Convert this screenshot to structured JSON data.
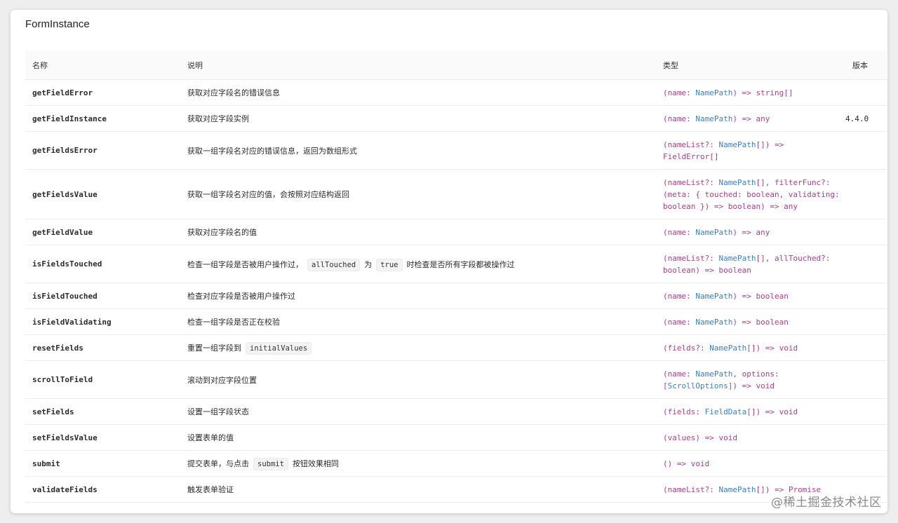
{
  "section_title": "FormInstance",
  "columns": {
    "name": "名称",
    "desc": "说明",
    "type": "类型",
    "version": "版本"
  },
  "rows": [
    {
      "name": "getFieldError",
      "desc": [
        "获取对应字段名的错误信息"
      ],
      "type": [
        [
          "p",
          "(name: "
        ],
        [
          "t",
          "NamePath"
        ],
        [
          "p",
          ") => string[]"
        ]
      ],
      "version": ""
    },
    {
      "name": "getFieldInstance",
      "desc": [
        "获取对应字段实例"
      ],
      "type": [
        [
          "p",
          "(name: "
        ],
        [
          "t",
          "NamePath"
        ],
        [
          "p",
          ") => any"
        ]
      ],
      "version": "4.4.0"
    },
    {
      "name": "getFieldsError",
      "desc": [
        "获取一组字段名对应的错误信息，返回为数组形式"
      ],
      "type": [
        [
          "p",
          "(nameList?: "
        ],
        [
          "t",
          "NamePath"
        ],
        [
          "p",
          "[]) =>"
        ],
        [
          "br",
          ""
        ],
        [
          "p",
          "FieldError[]"
        ]
      ],
      "version": ""
    },
    {
      "name": "getFieldsValue",
      "desc": [
        "获取一组字段名对应的值，会按照对应结构返回"
      ],
      "type": [
        [
          "p",
          "(nameList?: "
        ],
        [
          "t",
          "NamePath"
        ],
        [
          "p",
          "[], filterFunc?:"
        ],
        [
          "br",
          ""
        ],
        [
          "p",
          "(meta: { touched: boolean, validating:"
        ],
        [
          "br",
          ""
        ],
        [
          "p",
          "boolean }) => boolean) => any"
        ]
      ],
      "version": ""
    },
    {
      "name": "getFieldValue",
      "desc": [
        "获取对应字段名的值"
      ],
      "type": [
        [
          "p",
          "(name: "
        ],
        [
          "t",
          "NamePath"
        ],
        [
          "p",
          ") => any"
        ]
      ],
      "version": ""
    },
    {
      "name": "isFieldsTouched",
      "desc": [
        "检查一组字段是否被用户操作过，",
        "allTouched",
        "为",
        "true",
        "时检查是否所有字段都被操作过"
      ],
      "type": [
        [
          "p",
          "(nameList?: "
        ],
        [
          "t",
          "NamePath"
        ],
        [
          "p",
          "[], allTouched?:"
        ],
        [
          "br",
          ""
        ],
        [
          "p",
          "boolean) => boolean"
        ]
      ],
      "version": ""
    },
    {
      "name": "isFieldTouched",
      "desc": [
        "检查对应字段是否被用户操作过"
      ],
      "type": [
        [
          "p",
          "(name: "
        ],
        [
          "t",
          "NamePath"
        ],
        [
          "p",
          ") => boolean"
        ]
      ],
      "version": ""
    },
    {
      "name": "isFieldValidating",
      "desc": [
        "检查一组字段是否正在校验"
      ],
      "type": [
        [
          "p",
          "(name: "
        ],
        [
          "t",
          "NamePath"
        ],
        [
          "p",
          ") => boolean"
        ]
      ],
      "version": ""
    },
    {
      "name": "resetFields",
      "desc": [
        "重置一组字段到",
        "initialValues"
      ],
      "type": [
        [
          "p",
          "(fields?: "
        ],
        [
          "t",
          "NamePath"
        ],
        [
          "p",
          "[]) => void"
        ]
      ],
      "version": ""
    },
    {
      "name": "scrollToField",
      "desc": [
        "滚动到对应字段位置"
      ],
      "type": [
        [
          "p",
          "(name: "
        ],
        [
          "t",
          "NamePath"
        ],
        [
          "p",
          ", options:"
        ],
        [
          "br",
          ""
        ],
        [
          "p",
          "["
        ],
        [
          "t",
          "ScrollOptions"
        ],
        [
          "p",
          "]) => void"
        ]
      ],
      "version": ""
    },
    {
      "name": "setFields",
      "desc": [
        "设置一组字段状态"
      ],
      "type": [
        [
          "p",
          "(fields: "
        ],
        [
          "t",
          "FieldData"
        ],
        [
          "p",
          "[]) => void"
        ]
      ],
      "version": ""
    },
    {
      "name": "setFieldsValue",
      "desc": [
        "设置表单的值"
      ],
      "type": [
        [
          "p",
          "(values) => void"
        ]
      ],
      "version": ""
    },
    {
      "name": "submit",
      "desc": [
        "提交表单，与点击",
        "submit",
        "按钮效果相同"
      ],
      "type": [
        [
          "p",
          "() => void"
        ]
      ],
      "version": ""
    },
    {
      "name": "validateFields",
      "desc": [
        "触发表单验证"
      ],
      "type": [
        [
          "p",
          "(nameList?: "
        ],
        [
          "t",
          "NamePath"
        ],
        [
          "p",
          "[]) => Promise"
        ]
      ],
      "version": ""
    }
  ],
  "watermark": "@稀土掘金技术社区",
  "colors": {
    "punctuation": "#b03c8c",
    "type_name": "#3b7fc4",
    "code_bg": "#f3f3f3"
  }
}
